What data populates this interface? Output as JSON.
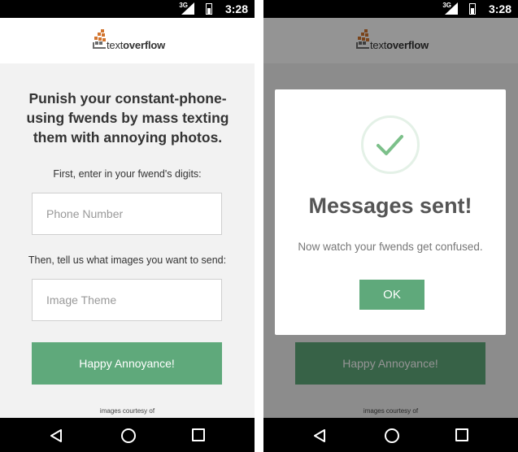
{
  "status_bar": {
    "network": "3G",
    "time": "3:28"
  },
  "header": {
    "logo_text_plain": "text",
    "logo_text_bold": "overflow"
  },
  "form": {
    "headline": "Punish your constant-phone-using fwends by mass texting them with annoying photos.",
    "phone_label": "First, enter in your fwend's digits:",
    "phone_placeholder": "Phone Number",
    "theme_label": "Then, tell us what images you want to send:",
    "theme_placeholder": "Image Theme",
    "submit_label": "Happy Annoyance!",
    "credit": "images courtesy of"
  },
  "dialog": {
    "title": "Messages sent!",
    "message": "Now watch your fwends get confused.",
    "ok_label": "OK"
  },
  "colors": {
    "accent": "#5fa97b",
    "logo_orange": "#d2752f",
    "logo_gray": "#6b6b6b"
  },
  "icons": [
    "signal-icon",
    "battery-icon",
    "back-icon",
    "home-icon",
    "recents-icon",
    "checkmark-icon",
    "logo-icon"
  ]
}
